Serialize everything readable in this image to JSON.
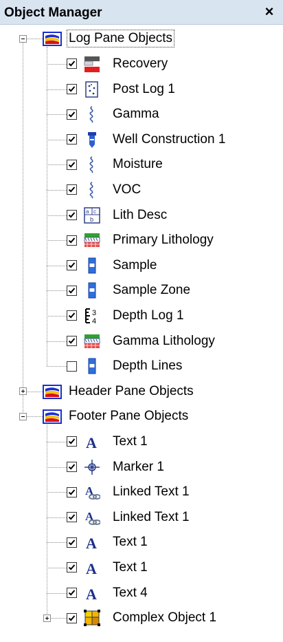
{
  "window": {
    "title": "Object Manager",
    "close_glyph": "×"
  },
  "groups": [
    {
      "label": "Log Pane Objects",
      "expanded": true,
      "icon": "pane-group-icon",
      "items": [
        {
          "label": "Recovery",
          "checked": true,
          "icon": "recovery-icon"
        },
        {
          "label": "Post Log 1",
          "checked": true,
          "icon": "post-log-icon"
        },
        {
          "label": "Gamma",
          "checked": true,
          "icon": "curve-icon"
        },
        {
          "label": "Well Construction 1",
          "checked": true,
          "icon": "well-construction-icon"
        },
        {
          "label": "Moisture",
          "checked": true,
          "icon": "curve-icon"
        },
        {
          "label": "VOC",
          "checked": true,
          "icon": "curve-icon"
        },
        {
          "label": "Lith Desc",
          "checked": true,
          "icon": "lith-desc-icon"
        },
        {
          "label": "Primary Lithology",
          "checked": true,
          "icon": "lithology-icon"
        },
        {
          "label": "Sample",
          "checked": true,
          "icon": "sample-icon"
        },
        {
          "label": "Sample Zone",
          "checked": true,
          "icon": "sample-icon"
        },
        {
          "label": "Depth Log 1",
          "checked": true,
          "icon": "depth-log-icon"
        },
        {
          "label": "Gamma Lithology",
          "checked": true,
          "icon": "lithology-icon"
        },
        {
          "label": "Depth Lines",
          "checked": false,
          "icon": "sample-icon"
        }
      ]
    },
    {
      "label": "Header Pane Objects",
      "expanded": false,
      "icon": "pane-group-icon",
      "items": []
    },
    {
      "label": "Footer Pane Objects",
      "expanded": true,
      "icon": "pane-group-icon",
      "items": [
        {
          "label": "Text 1",
          "checked": true,
          "icon": "text-icon"
        },
        {
          "label": "Marker 1",
          "checked": true,
          "icon": "marker-icon"
        },
        {
          "label": "Linked Text 1",
          "checked": true,
          "icon": "linked-text-icon"
        },
        {
          "label": "Linked Text 1",
          "checked": true,
          "icon": "linked-text-icon"
        },
        {
          "label": "Text 1",
          "checked": true,
          "icon": "text-icon"
        },
        {
          "label": "Text 1",
          "checked": true,
          "icon": "text-icon"
        },
        {
          "label": "Text 4",
          "checked": true,
          "icon": "text-icon"
        },
        {
          "label": "Complex Object 1",
          "checked": true,
          "icon": "complex-object-icon",
          "has_children": true
        }
      ]
    }
  ],
  "colors": {
    "title_bg": "#d9e4f1",
    "tree_line": "#8c8c8c",
    "group_icon_blue": "#1a2fd0",
    "group_icon_red": "#d81414",
    "group_icon_yellow": "#f4c20d"
  }
}
